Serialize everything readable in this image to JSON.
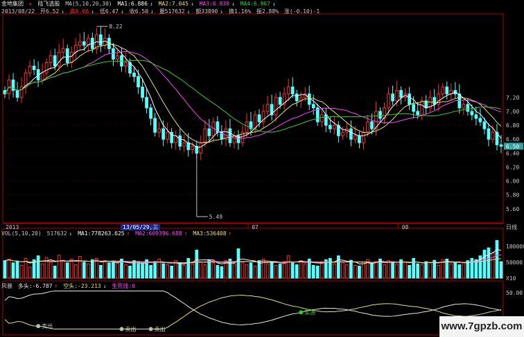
{
  "header": {
    "stock_name": "金地集团",
    "indicator_name": "陆飞选股",
    "ma_params": "MA(5,10,20,30)",
    "ma1": "MA1:6.886",
    "ma2": "MA2:7.045",
    "ma3": "MA3:6.939",
    "ma4": "MA4:6.967",
    "date": "2013/08/22",
    "open": "开6.52",
    "high": "高6.66",
    "low": "低6.47",
    "close": "收6.50",
    "volume": "量517632",
    "amount": "额33890",
    "turnover": "换1.16%",
    "amplitude": "振2.88%",
    "change": "涨(-0.10)-1"
  },
  "price_axis": [
    "7.20",
    "7.00",
    "6.80",
    "6.60",
    "6.40",
    "6.20",
    "6.00",
    "5.80",
    "5.60"
  ],
  "current_price_tag": "6.50",
  "annotations": {
    "high": "8.22",
    "low": "5.49"
  },
  "date_axis": {
    "start": "2013",
    "highlight": "13/05/29,三",
    "m07": "07",
    "m08": "08",
    "period": "日线"
  },
  "volume_panel": {
    "title": "VOL(5,10,20)",
    "vol": "517632",
    "ma1": "MA1:778263.625",
    "ma2": "MA2:609396.688",
    "ma3": "MA3:536408",
    "axis": [
      "100000",
      "50000"
    ],
    "unit": "X10"
  },
  "indicator_panel": {
    "name": "风暴",
    "long": "多头:-6.787",
    "short": "空头:-23.213",
    "life_line": "生死线:0",
    "axis": [
      "50.00"
    ],
    "buy_label": "买进",
    "sell_label": "卖出"
  },
  "colors": {
    "up": "#ff3030",
    "down": "#55ffff",
    "ma1": "#ffffff",
    "ma2": "#e8e070",
    "ma3": "#ff44ff",
    "ma4": "#30d030",
    "grid": "#b00000"
  },
  "watermark": "www.7gpzb.com",
  "chart_data": {
    "type": "candlestick",
    "x": [
      1,
      2,
      3,
      4,
      5,
      6,
      7,
      8,
      9,
      10,
      11,
      12,
      13,
      14,
      15,
      16,
      17,
      18,
      19,
      20,
      21,
      22,
      23,
      24,
      25,
      26,
      27,
      28,
      29,
      30,
      31,
      32,
      33,
      34,
      35,
      36,
      37,
      38,
      39,
      40,
      41,
      42,
      43,
      44,
      45,
      46,
      47,
      48,
      49,
      50,
      51,
      52,
      53,
      54,
      55,
      56,
      57,
      58,
      59,
      60,
      61,
      62,
      63,
      64,
      65,
      66,
      67,
      68,
      69,
      70,
      71,
      72,
      73,
      74,
      75,
      76,
      77,
      78,
      79,
      80,
      81,
      82,
      83,
      84,
      85,
      86,
      87,
      88,
      89,
      90,
      91,
      92,
      93,
      94,
      95,
      96,
      97,
      98,
      99,
      100,
      101,
      102,
      103,
      104,
      105,
      106,
      107,
      108,
      109,
      110,
      111,
      112,
      113,
      114,
      115,
      116,
      117,
      118,
      119,
      120
    ],
    "open": [
      7.3,
      7.25,
      7.45,
      7.3,
      7.2,
      7.35,
      7.55,
      7.65,
      7.6,
      7.45,
      7.55,
      7.7,
      7.8,
      7.65,
      7.85,
      7.9,
      7.7,
      7.85,
      7.95,
      8.0,
      7.95,
      8.05,
      7.9,
      8.1,
      7.95,
      8.05,
      7.9,
      7.75,
      7.8,
      7.65,
      7.7,
      7.55,
      7.5,
      7.35,
      7.2,
      7.05,
      6.9,
      6.7,
      6.75,
      6.6,
      6.7,
      6.55,
      6.65,
      6.5,
      6.55,
      6.45,
      6.5,
      6.4,
      6.55,
      6.75,
      6.65,
      6.85,
      6.7,
      6.6,
      6.75,
      6.55,
      6.65,
      6.55,
      6.7,
      6.85,
      6.75,
      6.95,
      6.85,
      7.0,
      7.1,
      6.95,
      7.2,
      7.1,
      7.25,
      7.35,
      7.25,
      7.15,
      7.2,
      7.25,
      7.1,
      7.05,
      6.85,
      6.95,
      6.8,
      6.75,
      6.8,
      6.65,
      6.7,
      6.75,
      6.6,
      6.65,
      6.55,
      6.7,
      6.85,
      6.75,
      7.0,
      6.9,
      7.05,
      7.25,
      7.15,
      7.3,
      7.2,
      7.25,
      7.1,
      7.0,
      6.95,
      7.15,
      7.05,
      7.2,
      7.1,
      7.25,
      7.35,
      7.25,
      7.3,
      7.25,
      7.05,
      7.1,
      7.0,
      6.95,
      6.9,
      6.85,
      6.75,
      6.6,
      6.7,
      6.52
    ],
    "close": [
      7.25,
      7.45,
      7.3,
      7.2,
      7.35,
      7.55,
      7.65,
      7.6,
      7.45,
      7.55,
      7.7,
      7.8,
      7.65,
      7.85,
      7.9,
      7.7,
      7.85,
      7.95,
      8.0,
      7.95,
      8.05,
      7.9,
      8.1,
      7.95,
      8.05,
      7.9,
      7.75,
      7.8,
      7.65,
      7.7,
      7.55,
      7.5,
      7.35,
      7.2,
      7.05,
      6.9,
      6.7,
      6.75,
      6.6,
      6.7,
      6.55,
      6.65,
      6.5,
      6.55,
      6.45,
      6.5,
      6.4,
      6.55,
      6.75,
      6.65,
      6.85,
      6.7,
      6.6,
      6.75,
      6.55,
      6.65,
      6.55,
      6.7,
      6.85,
      6.75,
      6.95,
      6.85,
      7.0,
      7.1,
      6.95,
      7.2,
      7.1,
      7.25,
      7.35,
      7.25,
      7.15,
      7.2,
      7.25,
      7.1,
      7.05,
      6.85,
      6.95,
      6.8,
      6.75,
      6.8,
      6.65,
      6.7,
      6.75,
      6.6,
      6.65,
      6.55,
      6.7,
      6.85,
      6.75,
      7.0,
      6.9,
      7.05,
      7.25,
      7.15,
      7.3,
      7.2,
      7.25,
      7.1,
      7.0,
      6.95,
      7.15,
      7.05,
      7.2,
      7.1,
      7.25,
      7.35,
      7.25,
      7.3,
      7.25,
      7.05,
      7.1,
      7.0,
      6.95,
      6.9,
      6.85,
      6.75,
      6.6,
      6.7,
      6.52,
      6.5
    ],
    "volume": [
      55000,
      60000,
      48000,
      52000,
      40000,
      62000,
      35000,
      58000,
      70000,
      45000,
      65000,
      50000,
      38000,
      72000,
      55000,
      48000,
      60000,
      42000,
      68000,
      50000,
      45000,
      58000,
      62000,
      40000,
      55000,
      48000,
      52000,
      46000,
      60000,
      42000,
      38000,
      55000,
      50000,
      44000,
      58000,
      40000,
      52000,
      60000,
      45000,
      42000,
      38000,
      55000,
      48000,
      40000,
      62000,
      45000,
      88000,
      50000,
      42000,
      58000,
      48000,
      40000,
      36000,
      55000,
      60000,
      45000,
      92000,
      50000,
      42000,
      48000,
      38000,
      55000,
      60000,
      45000,
      50000,
      40000,
      44000,
      52000,
      70000,
      48000,
      42000,
      55000,
      45000,
      60000,
      40000,
      38000,
      52000,
      58000,
      62000,
      45000,
      70000,
      48000,
      42000,
      56000,
      40000,
      38000,
      50000,
      58000,
      45000,
      52000,
      60000,
      42000,
      55000,
      48000,
      44000,
      58000,
      50000,
      40000,
      62000,
      45000,
      42000,
      52000,
      48000,
      56000,
      40000,
      58000,
      60000,
      45000,
      50000,
      42000,
      48000,
      55000,
      62000,
      58000,
      70000,
      88000,
      95000,
      82000,
      118000,
      51763
    ]
  }
}
